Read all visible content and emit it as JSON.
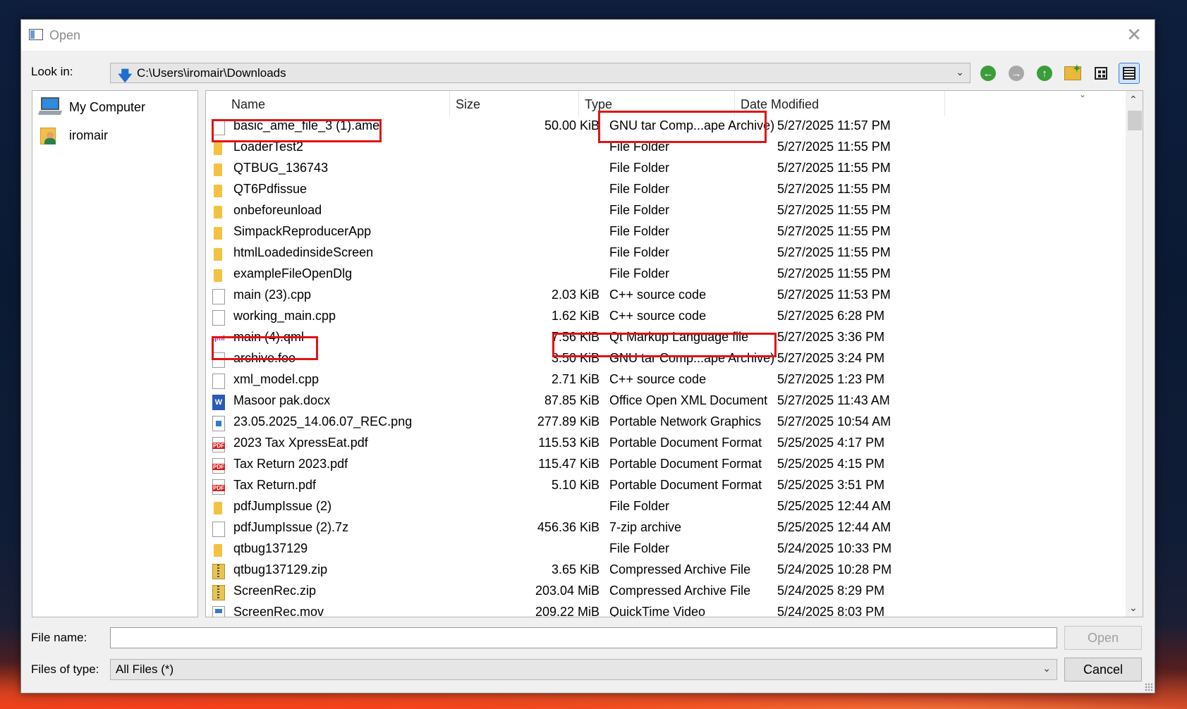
{
  "window": {
    "title": "Open",
    "close_glyph": "✕"
  },
  "look_in": {
    "label": "Look in:",
    "path": "C:\\Users\\iromair\\Downloads"
  },
  "toolbar": {
    "back_icon": "back-arrow-icon",
    "forward_icon": "forward-arrow-icon",
    "up_icon": "parent-directory-icon",
    "new_folder_icon": "new-folder-icon",
    "list_view_icon": "list-view-icon",
    "detail_view_icon": "detail-view-icon"
  },
  "sidebar": {
    "items": [
      {
        "label": "My Computer",
        "icon": "computer-icon"
      },
      {
        "label": "iromair",
        "icon": "user-folder-icon"
      }
    ]
  },
  "columns": {
    "name": "Name",
    "size": "Size",
    "type": "Type",
    "date": "Date Modified"
  },
  "files": [
    {
      "name": "basic_ame_file_3 (1).ame",
      "size": "50.00 KiB",
      "type": "GNU tar Comp...ape Archive)",
      "date": "5/27/2025 11:57 PM",
      "icon": "file"
    },
    {
      "name": "LoaderTest2",
      "size": "",
      "type": "File Folder",
      "date": "5/27/2025 11:55 PM",
      "icon": "folder"
    },
    {
      "name": "QTBUG_136743",
      "size": "",
      "type": "File Folder",
      "date": "5/27/2025 11:55 PM",
      "icon": "folder"
    },
    {
      "name": "QT6Pdfissue",
      "size": "",
      "type": "File Folder",
      "date": "5/27/2025 11:55 PM",
      "icon": "folder"
    },
    {
      "name": "onbeforeunload",
      "size": "",
      "type": "File Folder",
      "date": "5/27/2025 11:55 PM",
      "icon": "folder"
    },
    {
      "name": "SimpackReproducerApp",
      "size": "",
      "type": "File Folder",
      "date": "5/27/2025 11:55 PM",
      "icon": "folder"
    },
    {
      "name": "htmlLoadedinsideScreen",
      "size": "",
      "type": "File Folder",
      "date": "5/27/2025 11:55 PM",
      "icon": "folder"
    },
    {
      "name": "exampleFileOpenDlg",
      "size": "",
      "type": "File Folder",
      "date": "5/27/2025 11:55 PM",
      "icon": "folder"
    },
    {
      "name": "main (23).cpp",
      "size": "2.03 KiB",
      "type": "C++ source code",
      "date": "5/27/2025 11:53 PM",
      "icon": "file"
    },
    {
      "name": "working_main.cpp",
      "size": "1.62 KiB",
      "type": "C++ source code",
      "date": "5/27/2025 6:28 PM",
      "icon": "file"
    },
    {
      "name": "main (4).qml",
      "size": "7.56 KiB",
      "type": "Qt Markup Language file",
      "date": "5/27/2025 3:36 PM",
      "icon": "qml"
    },
    {
      "name": "archive.foo",
      "size": "3.50 KiB",
      "type": "GNU tar Comp...ape Archive)",
      "date": "5/27/2025 3:24 PM",
      "icon": "file"
    },
    {
      "name": "xml_model.cpp",
      "size": "2.71 KiB",
      "type": "C++ source code",
      "date": "5/27/2025 1:23 PM",
      "icon": "file"
    },
    {
      "name": "Masoor pak.docx",
      "size": "87.85 KiB",
      "type": "Office Open XML Document",
      "date": "5/27/2025 11:43 AM",
      "icon": "word"
    },
    {
      "name": "23.05.2025_14.06.07_REC.png",
      "size": "277.89 KiB",
      "type": "Portable Network Graphics",
      "date": "5/27/2025 10:54 AM",
      "icon": "png"
    },
    {
      "name": "2023 Tax XpressEat.pdf",
      "size": "115.53 KiB",
      "type": "Portable Document Format",
      "date": "5/25/2025 4:17 PM",
      "icon": "pdf"
    },
    {
      "name": "Tax Return 2023.pdf",
      "size": "115.47 KiB",
      "type": "Portable Document Format",
      "date": "5/25/2025 4:15 PM",
      "icon": "pdf"
    },
    {
      "name": "Tax Return.pdf",
      "size": "5.10 KiB",
      "type": "Portable Document Format",
      "date": "5/25/2025 3:51 PM",
      "icon": "pdf"
    },
    {
      "name": "pdfJumpIssue (2)",
      "size": "",
      "type": "File Folder",
      "date": "5/25/2025 12:44 AM",
      "icon": "folder"
    },
    {
      "name": "pdfJumpIssue (2).7z",
      "size": "456.36 KiB",
      "type": "7-zip archive",
      "date": "5/25/2025 12:44 AM",
      "icon": "file"
    },
    {
      "name": "qtbug137129",
      "size": "",
      "type": "File Folder",
      "date": "5/24/2025 10:33 PM",
      "icon": "folder"
    },
    {
      "name": "qtbug137129.zip",
      "size": "3.65 KiB",
      "type": "Compressed Archive File",
      "date": "5/24/2025 10:28 PM",
      "icon": "zip"
    },
    {
      "name": "ScreenRec.zip",
      "size": "203.04 MiB",
      "type": "Compressed Archive File",
      "date": "5/24/2025 8:29 PM",
      "icon": "zip"
    },
    {
      "name": "ScreenRec.mov",
      "size": "209.22 MiB",
      "type": "QuickTime Video",
      "date": "5/24/2025 8:03 PM",
      "icon": "mov"
    }
  ],
  "file_name": {
    "label": "File name:",
    "value": ""
  },
  "file_type": {
    "label": "Files of type:",
    "value": "All Files (*)"
  },
  "buttons": {
    "open": "Open",
    "cancel": "Cancel"
  },
  "annotation_color": "#e01414"
}
